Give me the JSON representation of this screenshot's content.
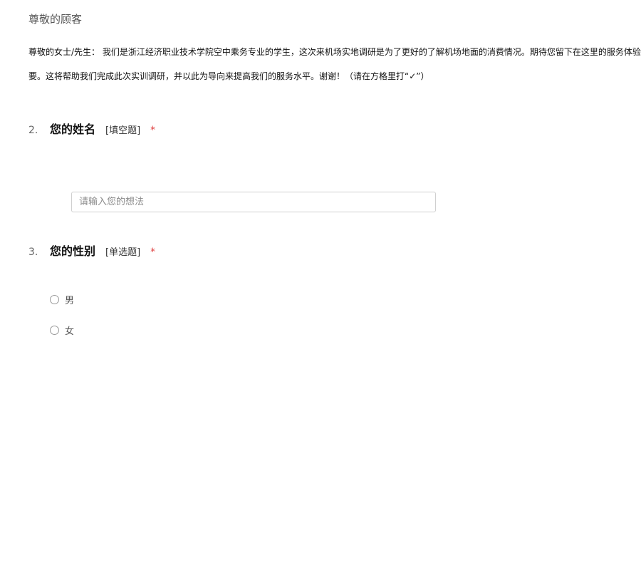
{
  "header": {
    "greeting": "尊敬的顾客"
  },
  "intro": {
    "line1": "尊敬的女士/先生： 我们是浙江经济职业技术学院空中乘务专业的学生，这次来机场实地调研是为了更好的了解机场地面的消费情况。期待您留下在这里的服务体验",
    "line2": "要。这将帮助我们完成此次实训调研，并以此为导向来提高我们的服务水平。谢谢！（请在方格里打“✓”）"
  },
  "questions": [
    {
      "number": "2.",
      "title": "您的姓名",
      "type": "[填空题]",
      "required_mark": "*",
      "input_placeholder": "请输入您的想法",
      "input_value": ""
    },
    {
      "number": "3.",
      "title": "您的性别",
      "type": "[单选题]",
      "required_mark": "*",
      "options": [
        {
          "label": "男",
          "selected": false
        },
        {
          "label": "女",
          "selected": false
        }
      ]
    }
  ],
  "colors": {
    "required": "#e04444",
    "input_border": "#d0d0d0",
    "radio_border": "#9a9a9a"
  }
}
